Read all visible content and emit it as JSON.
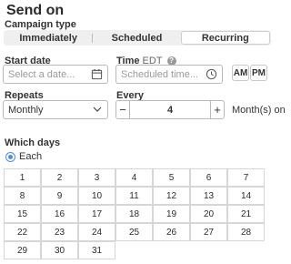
{
  "header": {
    "title": "Send on"
  },
  "campaign_type": {
    "label": "Campaign type",
    "options": [
      "Immediately",
      "Scheduled",
      "Recurring"
    ],
    "selected": "Recurring"
  },
  "start_date": {
    "label": "Start date",
    "placeholder": "Select a date..."
  },
  "time": {
    "label": "Time",
    "timezone": "EDT",
    "placeholder": "Scheduled time...",
    "am_label": "AM",
    "pm_label": "PM"
  },
  "repeats": {
    "label": "Repeats",
    "value": "Monthly"
  },
  "every": {
    "label": "Every",
    "value": "4",
    "minus": "−",
    "plus": "+",
    "unit": "Month(s) on"
  },
  "which_days": {
    "label": "Which days",
    "radio_label": "Each",
    "days": [
      "1",
      "2",
      "3",
      "4",
      "5",
      "6",
      "7",
      "8",
      "9",
      "10",
      "11",
      "12",
      "13",
      "14",
      "15",
      "16",
      "17",
      "18",
      "19",
      "20",
      "21",
      "22",
      "23",
      "24",
      "25",
      "26",
      "27",
      "28",
      "29",
      "30",
      "31"
    ]
  },
  "icons": {
    "calendar": "calendar-icon",
    "clock": "clock-icon",
    "help": "help-icon",
    "chevron": "chevron-down-icon"
  }
}
